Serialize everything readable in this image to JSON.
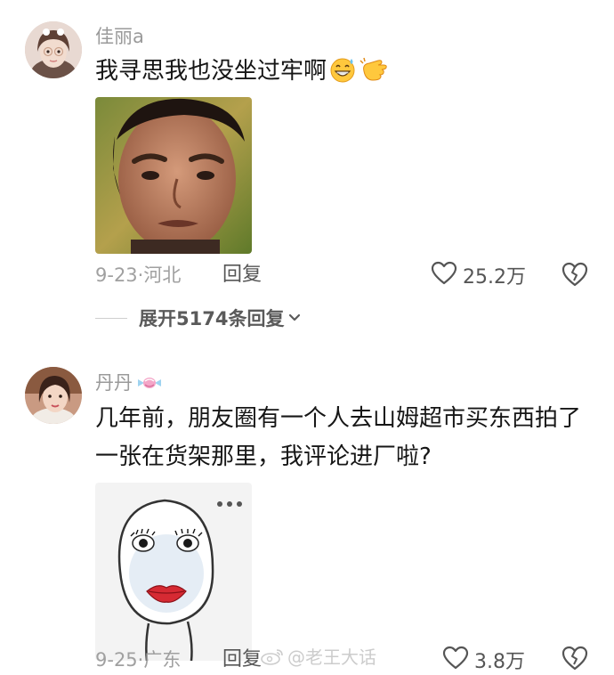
{
  "comments": [
    {
      "username": "佳丽a",
      "text": "我寻思我也没坐过牢啊",
      "emojis": [
        "grinning-sweat-emoji",
        "pointing-hand-emoji"
      ],
      "image": "man-face-photo",
      "date": "9-23",
      "location": "河北",
      "reply_label": "回复",
      "likes": "25.2万",
      "expand_label": "展开5174条回复"
    },
    {
      "username": "丹丹",
      "username_badge": "candy-icon",
      "text": "几年前，朋友圈有一个人去山姆超市买东西拍了一张在货架那里，我评论进厂啦?",
      "image": "cartoon-makeup-face",
      "date": "9-25",
      "location": "广东",
      "reply_label": "回复",
      "likes": "3.8万"
    }
  ],
  "watermark": "@老王大话",
  "separator": "·",
  "colors": {
    "text": "#161616",
    "muted": "#a0a0a0",
    "background": "#ffffff"
  }
}
